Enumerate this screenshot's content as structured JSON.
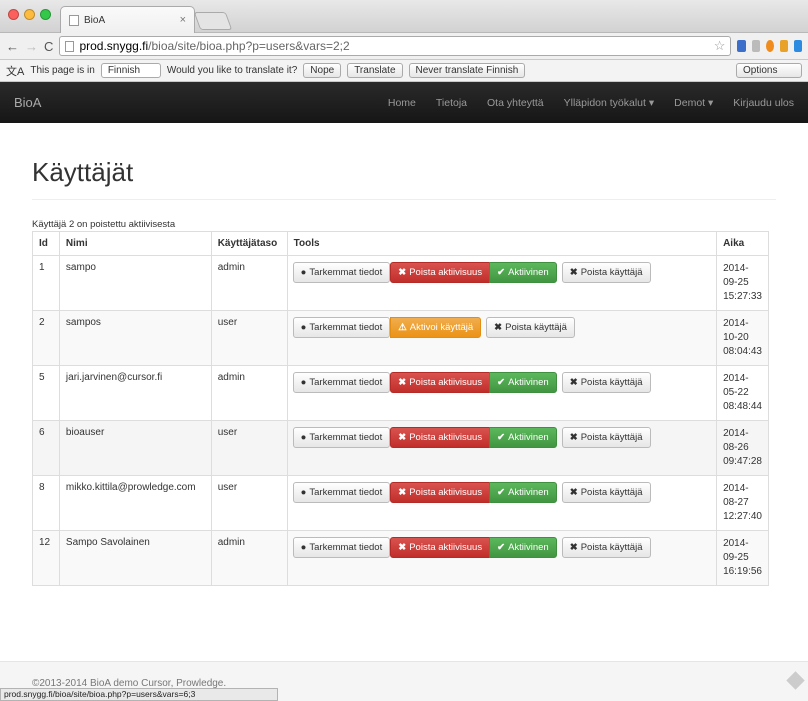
{
  "browser": {
    "tab_title": "BioA",
    "url_host": "prod.snygg.fi",
    "url_path": "/bioa/site/bioa.php?p=users&vars=2;2",
    "status_url": "prod.snygg.fi/bioa/site/bioa.php?p=users&vars=6;3"
  },
  "translate": {
    "prefix": "This page is in",
    "language": "Finnish",
    "question": "Would you like to translate it?",
    "nope": "Nope",
    "translate": "Translate",
    "never": "Never translate Finnish",
    "options": "Options"
  },
  "nav": {
    "brand": "BioA",
    "links": [
      "Home",
      "Tietoja",
      "Ota yhteyttä",
      "Ylläpidon työkalut",
      "Demot",
      "Kirjaudu ulos"
    ]
  },
  "page": {
    "title": "Käyttäjät",
    "notice": "Käyttäjä 2 on poistettu aktiivisesta",
    "headers": [
      "Id",
      "Nimi",
      "Käyttäjätaso",
      "Tools",
      "Aika"
    ],
    "rows": [
      {
        "id": "1",
        "name": "sampo",
        "level": "admin",
        "date": "2014-09-25",
        "time": "15:27:33"
      },
      {
        "id": "2",
        "name": "sampos",
        "level": "user",
        "date": "2014-10-20",
        "time": "08:04:43"
      },
      {
        "id": "5",
        "name": "jari.jarvinen@cursor.fi",
        "level": "admin",
        "date": "2014-05-22",
        "time": "08:48:44"
      },
      {
        "id": "6",
        "name": "bioauser",
        "level": "user",
        "date": "2014-08-26",
        "time": "09:47:28"
      },
      {
        "id": "8",
        "name": "mikko.kittila@prowledge.com",
        "level": "user",
        "date": "2014-08-27",
        "time": "12:27:40"
      },
      {
        "id": "12",
        "name": "Sampo Savolainen",
        "level": "admin",
        "date": "2014-09-25",
        "time": "16:19:56"
      }
    ],
    "buttons": {
      "details": "Tarkemmat tiedot",
      "remove_active": "Poista aktiivisuus",
      "active": "Aktiivinen",
      "activate": "Aktivoi käyttäjä",
      "delete": "Poista käyttäjä"
    }
  },
  "footer": {
    "text": "©2013-2014 BioA demo Cursor, Prowledge."
  },
  "colors": {
    "danger": "#d9534f",
    "success": "#5cb85c",
    "warning": "#f0ad4e",
    "navbar": "#222222"
  }
}
